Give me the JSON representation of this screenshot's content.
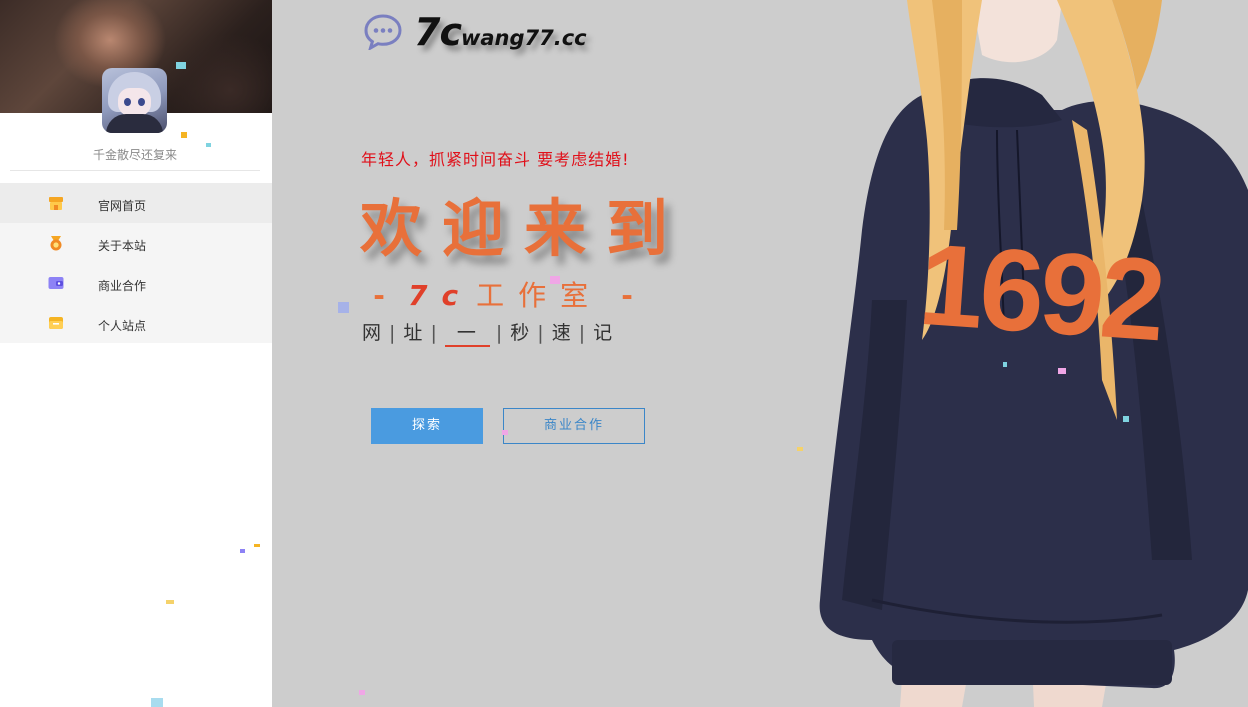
{
  "sidebar": {
    "motto": "千金散尽还复来",
    "items": [
      {
        "label": "官网首页",
        "icon": "home-store-icon",
        "color": "#f5a623"
      },
      {
        "label": "关于本站",
        "icon": "medal-icon",
        "color": "#f08a24"
      },
      {
        "label": "商业合作",
        "icon": "wallet-icon",
        "color": "#7b6cf0"
      },
      {
        "label": "个人站点",
        "icon": "folder-icon",
        "color": "#f5b423"
      }
    ]
  },
  "brand": {
    "logo_big": "7c",
    "logo_small": "wang77.cc",
    "icon": "chat-bubble-icon"
  },
  "hero": {
    "slogan": "年轻人，抓紧时间奋斗 要考虑结婚!",
    "welcome": "欢迎来到",
    "studio_dash": "-",
    "studio_logo": "7c",
    "studio_name": "工作室",
    "tagline": {
      "p1": "网",
      "p2": "址",
      "p3": "一",
      "p4": "秒",
      "p5": "速",
      "p6": "记",
      "sep": "|"
    }
  },
  "buttons": {
    "explore": "探索",
    "cooperate": "商业合作"
  },
  "illustration": {
    "shirt_number": "1692"
  },
  "colors": {
    "accent_orange": "#e8703a",
    "slogan_red": "#e0101a",
    "button_blue": "#4a9be0",
    "background_gray": "#cdcdcd"
  }
}
